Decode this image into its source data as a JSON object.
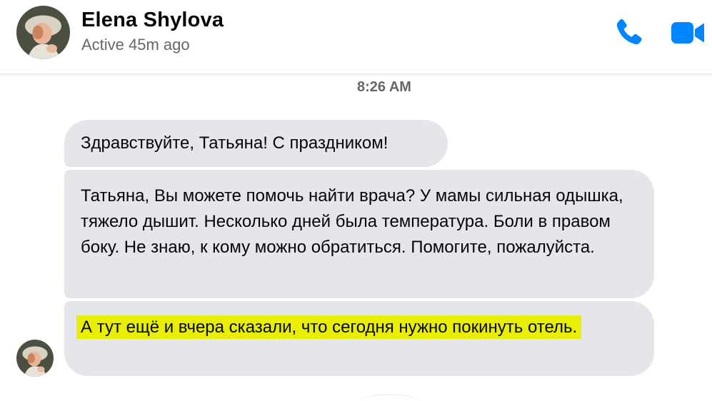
{
  "header": {
    "contact_name": "Elena Shylova",
    "status": "Active 45m ago",
    "call_icon": "phone-icon",
    "video_icon": "video-camera-icon",
    "accent_color": "#0084ff"
  },
  "conversation": {
    "timestamp": "8:26 AM",
    "messages": [
      {
        "text": "Здравствуйте, Татьяна! С праздником!"
      },
      {
        "text": "Татьяна, Вы можете помочь найти врача? У мамы сильная одышка, тяжело дышит. Несколько дней была температура. Боли в правом боку. Не знаю, к кому можно обратиться. Помогите, пожалуйста."
      },
      {
        "text": "А тут ещё и вчера сказали, что сегодня нужно покинуть отель.",
        "highlighted": true
      }
    ],
    "bubble_color": "#e4e6eb",
    "highlight_color": "#e9ef00"
  }
}
